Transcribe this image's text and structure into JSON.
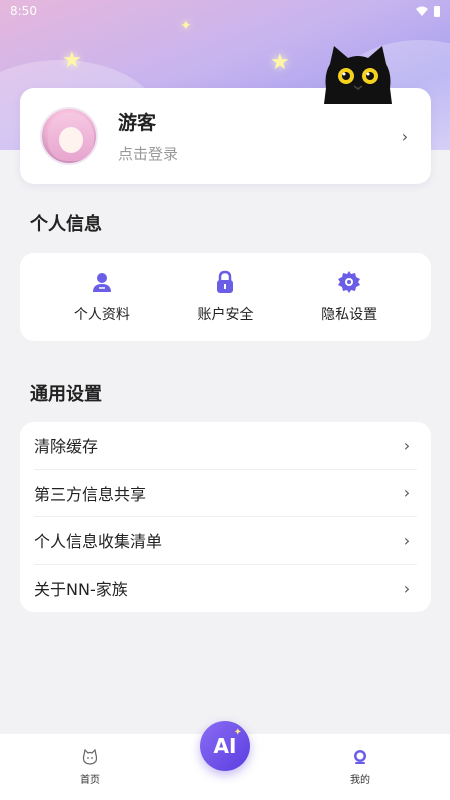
{
  "status_bar": {
    "time": "8:50"
  },
  "profile": {
    "name": "游客",
    "subtitle": "点击登录"
  },
  "personal_info": {
    "title": "个人信息",
    "items": [
      {
        "label": "个人资料",
        "icon": "person-icon"
      },
      {
        "label": "账户安全",
        "icon": "lock-icon"
      },
      {
        "label": "隐私设置",
        "icon": "gear-icon"
      }
    ]
  },
  "general_settings": {
    "title": "通用设置",
    "items": [
      {
        "label": "清除缓存"
      },
      {
        "label": "第三方信息共享"
      },
      {
        "label": "个人信息收集清单"
      },
      {
        "label": "关于NN-家族"
      }
    ]
  },
  "tabbar": {
    "home_label": "首页",
    "ai_label": "AI",
    "mine_label": "我的"
  },
  "colors": {
    "accent": "#6a4ee8",
    "icon_purple": "#6b5ee6",
    "background": "#f2f2f4"
  }
}
